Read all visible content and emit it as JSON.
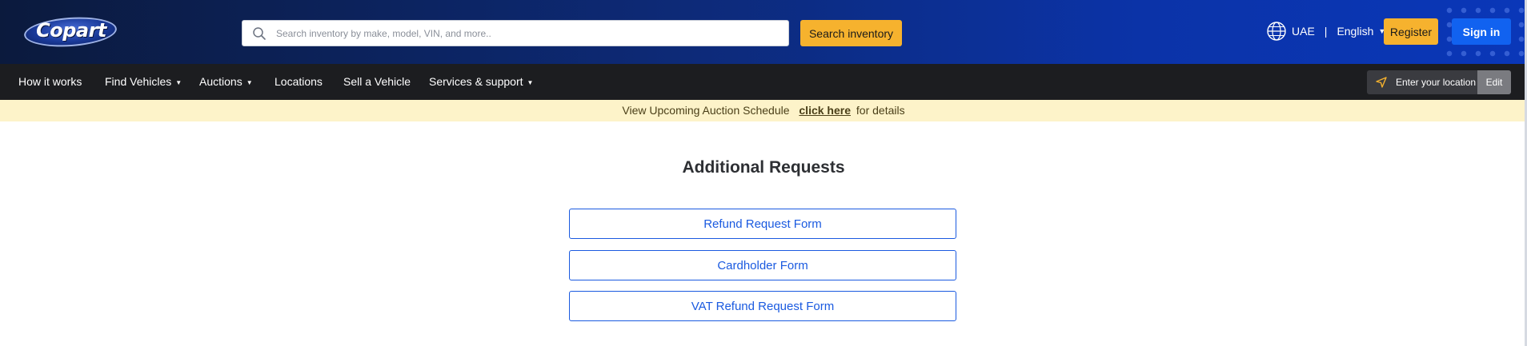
{
  "header": {
    "logo_text": "Copart",
    "search_placeholder": "Search inventory by make, model, VIN, and more..",
    "search_button": "Search inventory",
    "region": "UAE",
    "separator": "|",
    "language": "English",
    "register": "Register",
    "sign_in": "Sign in"
  },
  "nav": {
    "items": [
      {
        "label": "How it works",
        "has_caret": false
      },
      {
        "label": "Find Vehicles",
        "has_caret": true
      },
      {
        "label": "Auctions",
        "has_caret": true
      },
      {
        "label": "Locations",
        "has_caret": false
      },
      {
        "label": "Sell a Vehicle",
        "has_caret": false
      },
      {
        "label": "Services & support",
        "has_caret": true
      }
    ],
    "location_label": "Enter your location",
    "location_edit": "Edit"
  },
  "banner": {
    "prefix": "View Upcoming Auction Schedule",
    "link": "click here",
    "suffix": "for details"
  },
  "main": {
    "title": "Additional Requests",
    "forms": [
      {
        "label": "Refund Request Form"
      },
      {
        "label": "Cardholder Form"
      },
      {
        "label": "VAT Refund Request Form"
      }
    ]
  },
  "colors": {
    "header_bg": "#0d2a78",
    "nav_bg": "#1c1d20",
    "accent_yellow": "#f6b22e",
    "accent_blue": "#1162f0",
    "banner_bg": "#fdf3c9",
    "link_blue": "#1a5ae0"
  },
  "icons": {
    "search": "search-icon",
    "globe": "globe-icon",
    "location": "location-arrow-icon"
  }
}
